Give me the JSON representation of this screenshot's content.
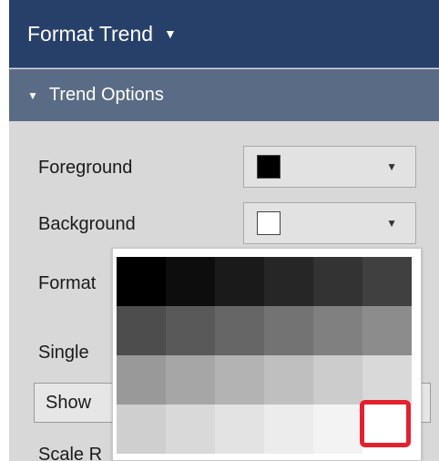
{
  "header": {
    "title": "Format Trend",
    "caret_icon": "caret-down-icon"
  },
  "section": {
    "title": "Trend Options",
    "caret_icon": "caret-down-icon"
  },
  "fields": {
    "foreground": {
      "label": "Foreground",
      "color": "#000000"
    },
    "background": {
      "label": "Background",
      "color": "#ffffff"
    },
    "format": {
      "label": "Format"
    },
    "single": {
      "label": "Single"
    },
    "show": {
      "label": "Show"
    },
    "scale": {
      "label": "Scale R"
    }
  },
  "palette": {
    "colors": [
      "#000000",
      "#0d0d0d",
      "#1a1a1a",
      "#262626",
      "#333333",
      "#404040",
      "#4d4d4d",
      "#595959",
      "#666666",
      "#737373",
      "#808080",
      "#8c8c8c",
      "#999999",
      "#a6a6a6",
      "#b3b3b3",
      "#bfbfbf",
      "#cccccc",
      "#d9d9d9",
      "#cfcfcf",
      "#d9d9d9",
      "#e3e3e3",
      "#ececec",
      "#f3f3f3",
      "#ffffff"
    ],
    "selected_index": 23,
    "selection_color": "#e5202e"
  }
}
